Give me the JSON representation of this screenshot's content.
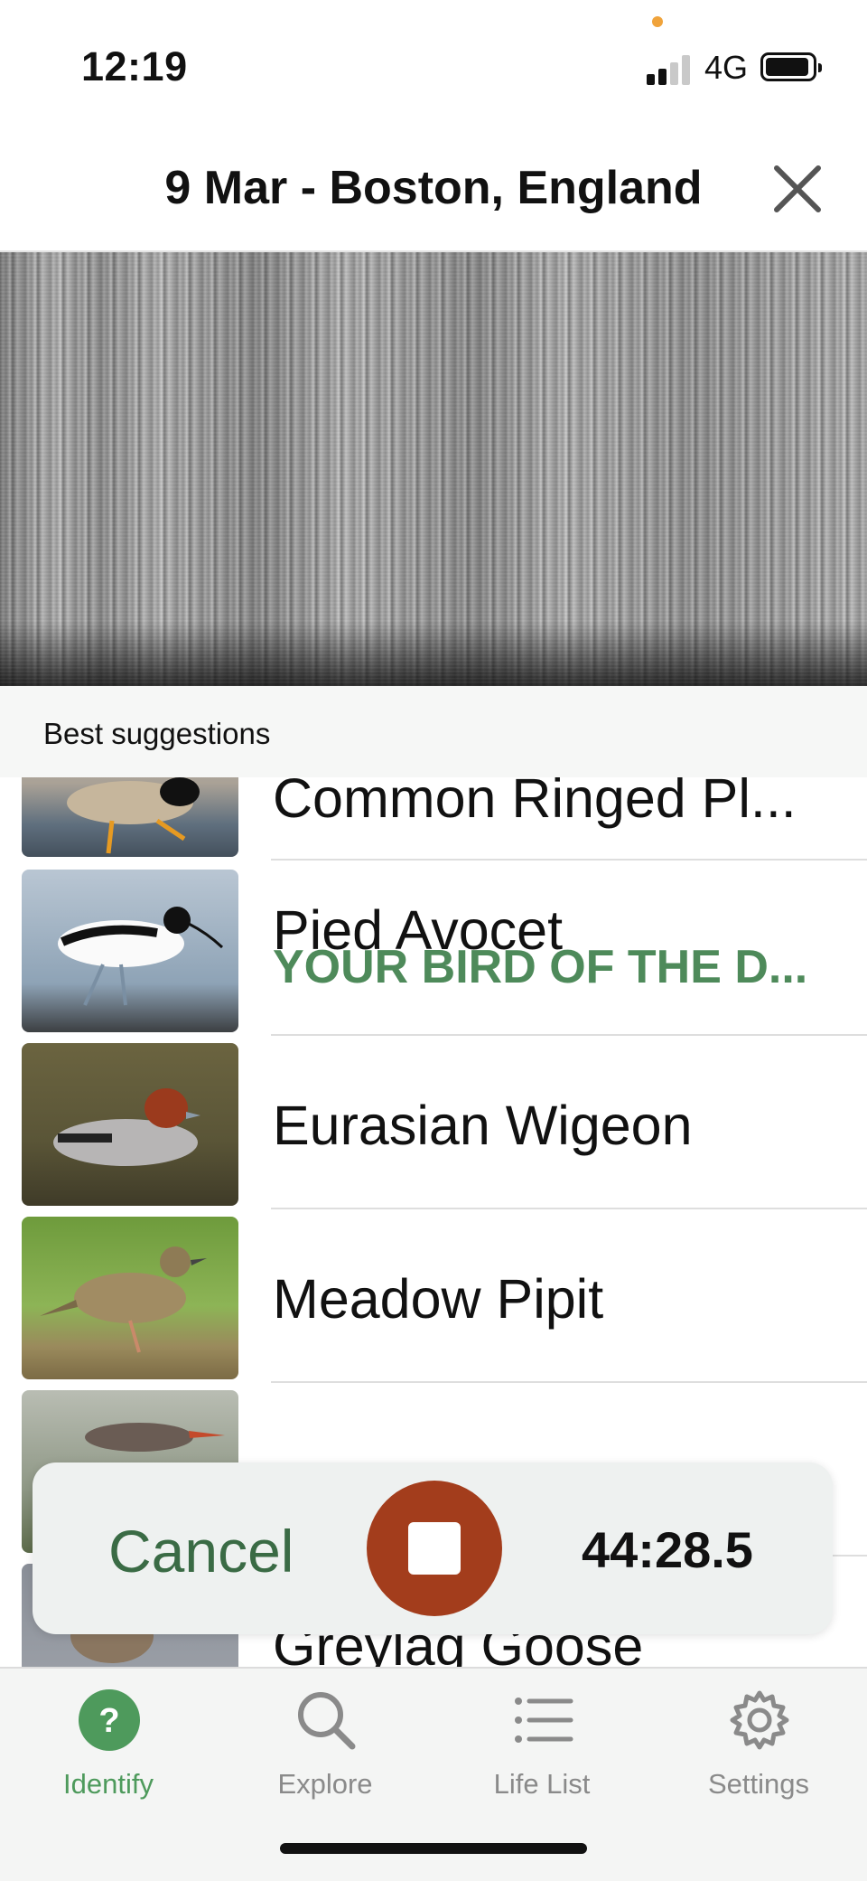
{
  "status_bar": {
    "time": "12:19",
    "network": "4G"
  },
  "header": {
    "title": "9 Mar - Boston, England"
  },
  "suggestions": {
    "label": "Best suggestions",
    "items": [
      {
        "name": "Common Ringed Pl...",
        "subtitle": ""
      },
      {
        "name": "Pied Avocet",
        "subtitle": "YOUR BIRD OF THE D..."
      },
      {
        "name": "Eurasian Wigeon",
        "subtitle": ""
      },
      {
        "name": "Meadow Pipit",
        "subtitle": ""
      },
      {
        "name": "",
        "subtitle": ""
      },
      {
        "name": "Greylag Goose",
        "subtitle": ""
      }
    ]
  },
  "recording": {
    "cancel_label": "Cancel",
    "timer": "44:28.5"
  },
  "tabs": [
    {
      "label": "Identify",
      "icon": "question-icon",
      "active": true
    },
    {
      "label": "Explore",
      "icon": "search-icon",
      "active": false
    },
    {
      "label": "Life List",
      "icon": "list-icon",
      "active": false
    },
    {
      "label": "Settings",
      "icon": "gear-icon",
      "active": false
    }
  ],
  "colors": {
    "accent_green": "#4e9a5c",
    "stop_red": "#a33d1c",
    "bird_of_day": "#4e8a5a"
  }
}
